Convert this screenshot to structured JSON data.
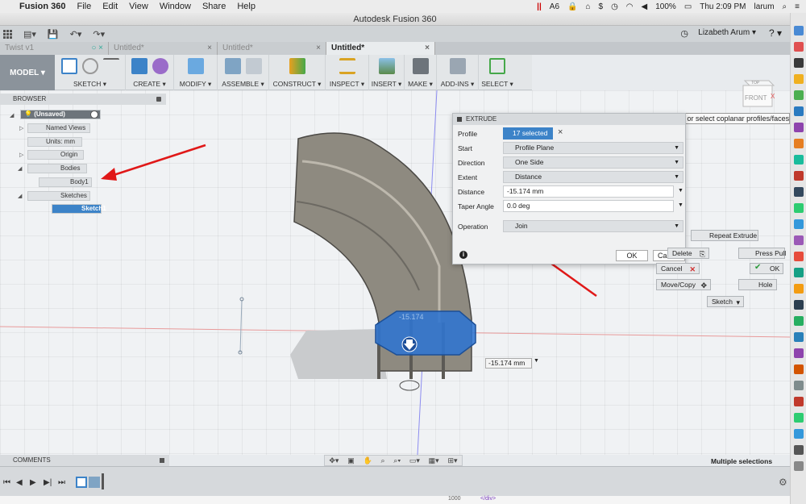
{
  "mac_menu": {
    "apple": "",
    "app_name": "Fusion 360",
    "items": [
      "File",
      "Edit",
      "View",
      "Window",
      "Share",
      "Help"
    ],
    "status_a6": "6",
    "battery": "100%",
    "time": "Thu 2:09 PM",
    "user_short": "larum"
  },
  "window_title": "Autodesk Fusion 360",
  "user_name": "Lizabeth Arum ▾",
  "help_glyph": "? ▾",
  "doc_tabs": [
    {
      "label": "Twist v1"
    },
    {
      "label": "Untitled*"
    },
    {
      "label": "Untitled*"
    },
    {
      "label": "Untitled*"
    }
  ],
  "toolbar": {
    "model": "MODEL ▾",
    "groups": [
      "SKETCH ▾",
      "CREATE ▾",
      "MODIFY ▾",
      "ASSEMBLE ▾",
      "CONSTRUCT ▾",
      "INSPECT ▾",
      "INSERT ▾",
      "MAKE ▾",
      "ADD-INS ▾",
      "SELECT ▾"
    ]
  },
  "browser": {
    "title": "BROWSER",
    "root": "(Unsaved)",
    "named_views": "Named Views",
    "units": "Units: mm",
    "origin": "Origin",
    "bodies": "Bodies",
    "body1": "Body1",
    "sketches": "Sketches",
    "sketch1": "Sketch1"
  },
  "viewcube": {
    "top": "TOP",
    "front": "FRONT"
  },
  "extrude": {
    "title": "EXTRUDE",
    "rows": {
      "profile": {
        "label": "Profile",
        "value": "17 selected"
      },
      "start": {
        "label": "Start",
        "value": "Profile Plane"
      },
      "direction": {
        "label": "Direction",
        "value": "One Side"
      },
      "extent": {
        "label": "Extent",
        "value": "Distance"
      },
      "distance": {
        "label": "Distance",
        "value": "-15.174 mm"
      },
      "taper": {
        "label": "Taper Angle",
        "value": "0.0 deg"
      },
      "operation": {
        "label": "Operation",
        "value": "Join"
      }
    },
    "ok": "OK",
    "cancel": "Cancel"
  },
  "tooltip": "Specify distance, or select coplanar profiles/faces",
  "marking_menu": {
    "repeat": "Repeat Extrude",
    "delete": "Delete",
    "press_pull": "Press Pull",
    "cancel": "Cancel",
    "ok": "OK",
    "move_copy": "Move/Copy",
    "hole": "Hole",
    "sketch": "Sketch"
  },
  "manipulator_value": "-15.174",
  "distance_input": "-15.174 mm",
  "comments": "COMMENTS",
  "multiple_selections": "Multiple selections",
  "code_snippet": "</div>",
  "code_line": "1000",
  "colors": {
    "accent": "#3c83c8",
    "body": "#8e8a80",
    "arrow": "#e01818"
  }
}
